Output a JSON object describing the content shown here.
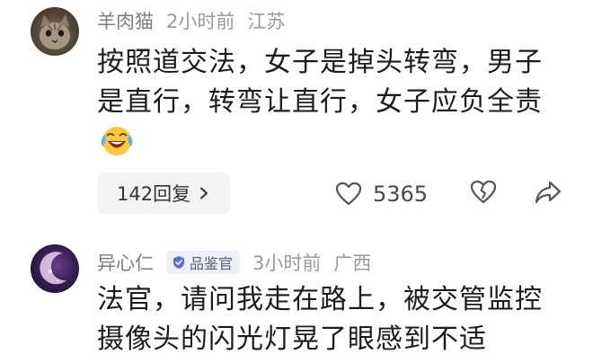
{
  "comments": [
    {
      "username": "羊肉猫",
      "time": "2小时前",
      "location": "江苏",
      "text": "按照道交法，女子是掉头转弯，男子是直行，转弯让直行，女子应负全责",
      "emoji": "laughing-crying-emoji",
      "replies": "142回复",
      "likes": "5365",
      "icons": [
        "heart-icon",
        "broken-heart-icon",
        "share-icon",
        "chevron-right-icon"
      ]
    },
    {
      "username": "异心仁",
      "badge": "品鉴官",
      "time": "3小时前",
      "location": "广西",
      "text": "法官，请问我走在路上，被交管监控摄像头的闪光灯晃了眼感到不适"
    }
  ],
  "colors": {
    "meta_gray": "#9a9a9a",
    "badge_bg": "#eef0f7",
    "badge_icon": "#5a6fd6",
    "reply_bg": "#f3f3f3"
  }
}
